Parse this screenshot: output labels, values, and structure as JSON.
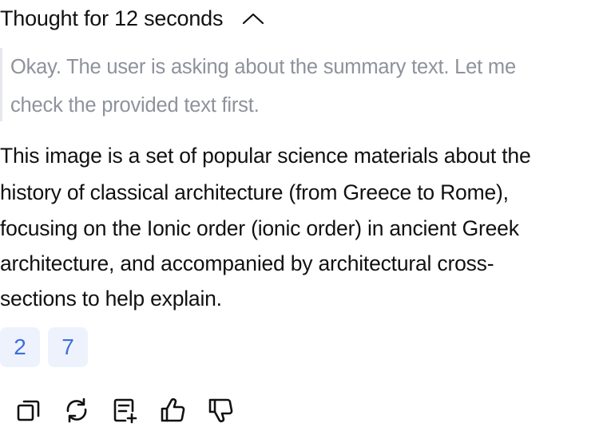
{
  "thought": {
    "title": "Thought for 12 seconds",
    "toggle_icon": "chevron-up-icon",
    "lines": [
      "Okay. The user is asking about the summary text. Let me",
      "check the provided text first."
    ]
  },
  "answer": {
    "lines": [
      "This image is a set of popular science materials about the",
      "history of classical architecture (from Greece to Rome),",
      "focusing on the Ionic order (ionic order) in ancient Greek",
      "architecture, and accompanied by architectural cross-",
      "sections to help explain."
    ]
  },
  "references": [
    "2",
    "7"
  ],
  "actions": [
    {
      "icon": "copy-icon"
    },
    {
      "icon": "regenerate-icon"
    },
    {
      "icon": "add-note-icon"
    },
    {
      "icon": "thumbs-up-icon"
    },
    {
      "icon": "thumbs-down-icon"
    }
  ],
  "colors": {
    "text": "#111111",
    "thought_text": "#8e929b",
    "thought_border": "#e5e7ec",
    "chip_bg": "#edf2fd",
    "chip_text": "#3e6fd9"
  }
}
